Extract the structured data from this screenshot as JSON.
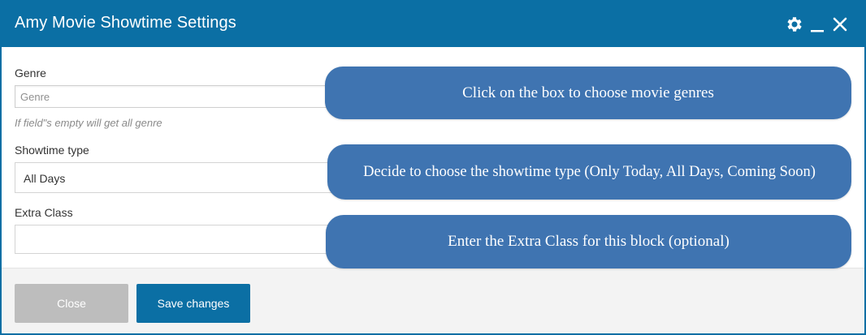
{
  "dialog": {
    "title": "Amy Movie Showtime Settings",
    "icons": [
      "gear-icon",
      "minimize-icon",
      "close-icon"
    ]
  },
  "form": {
    "genre": {
      "label": "Genre",
      "placeholder": "Genre",
      "hint": "If field\"s empty will get all genre"
    },
    "showtime_type": {
      "label": "Showtime type",
      "value": "All Days"
    },
    "extra_class": {
      "label": "Extra Class",
      "value": ""
    }
  },
  "footer": {
    "close_label": "Close",
    "save_label": "Save changes"
  },
  "callouts": [
    "Click on the box to choose movie genres",
    "Decide to choose the showtime type (Only Today, All Days, Coming Soon)",
    "Enter the Extra Class for this block (optional)"
  ],
  "colors": {
    "primary": "#0b6fa4",
    "callout": "#3f74b1",
    "close_button": "#bdbdbd",
    "footer_bg": "#f3f3f3"
  }
}
